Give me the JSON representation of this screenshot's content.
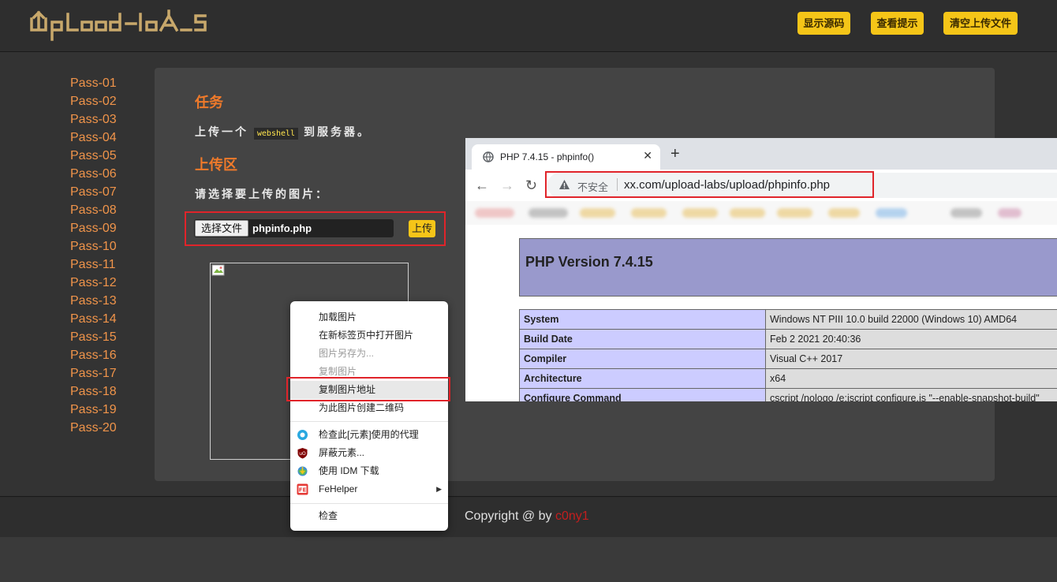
{
  "header": {
    "logo_text": "Upload-labs",
    "buttons": [
      "显示源码",
      "查看提示",
      "清空上传文件"
    ]
  },
  "menu": {
    "items": [
      "Pass-01",
      "Pass-02",
      "Pass-03",
      "Pass-04",
      "Pass-05",
      "Pass-06",
      "Pass-07",
      "Pass-08",
      "Pass-09",
      "Pass-10",
      "Pass-11",
      "Pass-12",
      "Pass-13",
      "Pass-14",
      "Pass-15",
      "Pass-16",
      "Pass-17",
      "Pass-18",
      "Pass-19",
      "Pass-20"
    ]
  },
  "task": {
    "heading": "任务",
    "text_before": "上传一个",
    "code": "webshell",
    "text_after": "到服务器。"
  },
  "upload": {
    "heading": "上传区",
    "prompt": "请选择要上传的图片：",
    "choose_label": "选择文件",
    "file_name": "phpinfo.php",
    "submit_label": "上传"
  },
  "context_menu": {
    "items": [
      {
        "label": "加载图片",
        "disabled": false
      },
      {
        "label": "在新标签页中打开图片",
        "disabled": false
      },
      {
        "label": "图片另存为...",
        "disabled": true
      },
      {
        "label": "复制图片",
        "disabled": true
      },
      {
        "label": "复制图片地址",
        "disabled": false,
        "highlighted": true
      },
      {
        "label": "为此图片创建二维码",
        "disabled": false
      }
    ],
    "extensions": [
      {
        "label": "检查此[元素]使用的代理",
        "icon": "proxy-icon"
      },
      {
        "label": "屏蔽元素...",
        "icon": "ublock-icon"
      },
      {
        "label": "使用 IDM 下载",
        "icon": "idm-icon"
      },
      {
        "label": "FeHelper",
        "icon": "fehelper-icon",
        "submenu": true
      }
    ],
    "inspect": "检查"
  },
  "footer": {
    "copyright": "Copyright @  by ",
    "author": "c0ny1"
  },
  "browser": {
    "tab_title": "PHP 7.4.15 - phpinfo()",
    "insecure_label": "不安全",
    "url": "xx.com/upload-labs/upload/phpinfo.php",
    "php_version": "PHP Version 7.4.15",
    "rows": [
      {
        "key": "System",
        "value": "Windows NT PIII 10.0 build 22000 (Windows 10) AMD64"
      },
      {
        "key": "Build Date",
        "value": "Feb 2 2021 20:40:36"
      },
      {
        "key": "Compiler",
        "value": "Visual C++ 2017"
      },
      {
        "key": "Architecture",
        "value": "x64"
      },
      {
        "key": "Configure Command",
        "value": "cscript /nologo /e:jscript configure.js \"--enable-snapshot-build\""
      }
    ]
  },
  "colors": {
    "accent_yellow": "#f5c518",
    "menu_orange": "#f0944a",
    "heading_orange": "#f07a2a",
    "highlight_red": "#e0242a"
  }
}
